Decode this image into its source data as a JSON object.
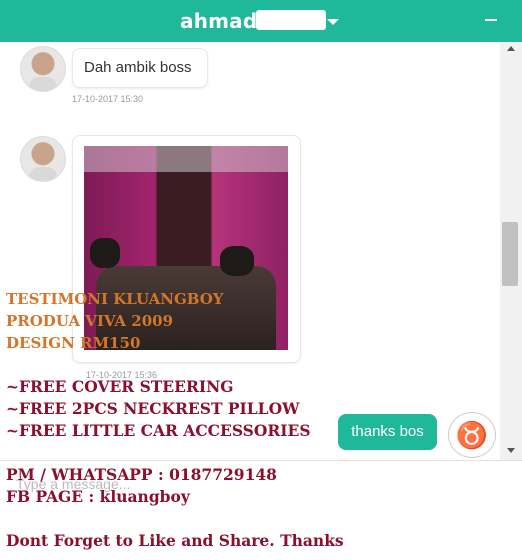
{
  "header": {
    "title": "ahmad",
    "redacted": true
  },
  "messages": [
    {
      "text": "Dah ambik boss",
      "timestamp": "17-10-2017 15:30"
    },
    {
      "timestamp": "17-10-2017 15:36",
      "image": "car-seat-photo"
    },
    {
      "text": "thanks bos",
      "sender": "self"
    }
  ],
  "input": {
    "placeholder": "Type a message..."
  },
  "overlay": {
    "orange_lines": [
      "TESTIMONI KLUANGBOY",
      "PRODUA VIVA 2009",
      "DESIGN RM150"
    ],
    "free_lines": [
      "~FREE COVER STEERING",
      "~FREE 2PCS NECKREST PILLOW",
      "~FREE LITTLE CAR ACCESSORIES"
    ],
    "contact_lines": [
      "PM / WHATSAPP : 0187729148",
      "FB PAGE : kluangboy"
    ],
    "footer": "Dont Forget to Like and Share. Thanks"
  },
  "colors": {
    "accent": "#20b89a",
    "orange": "#d2762b",
    "maroon": "#8b0f2e"
  }
}
